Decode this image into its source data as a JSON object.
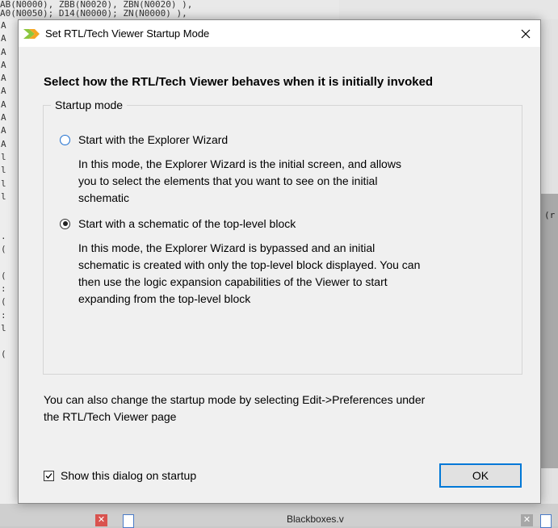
{
  "background": {
    "code_top_line": "AB(N0000), ZBB(N0020), ZBN(N0020)  ),",
    "code_second_line": "A0(N0050);  D14(N0000);  ZN(N0000)  ),",
    "gutter_lines": [
      "A",
      "A",
      "A",
      "A",
      "A",
      "A",
      "A",
      "A",
      "A",
      "A",
      "l",
      "l",
      "l",
      "l",
      "",
      "",
      ".",
      "(",
      "",
      "(",
      ":",
      "(",
      ":",
      "l",
      "",
      "(",
      ""
    ],
    "right_edge_text": "(r",
    "bottom_tab_label": "Blackboxes.v"
  },
  "dialog": {
    "title": "Set RTL/Tech Viewer Startup Mode",
    "heading": "Select how the RTL/Tech Viewer behaves when it is initially invoked",
    "group_label": "Startup mode",
    "options": [
      {
        "label": "Start with the Explorer Wizard",
        "selected": false,
        "description_lines": [
          "In this mode, the Explorer Wizard is the initial screen, and allows",
          "you to select the elements that you want to see on the initial",
          "schematic"
        ]
      },
      {
        "label": "Start with a schematic of the top-level block",
        "selected": true,
        "description_lines": [
          "In this mode, the Explorer Wizard is bypassed and an initial",
          "schematic is created with only the top-level block displayed. You can",
          "then use the logic expansion capabilities of the Viewer to start",
          "expanding from the top-level block"
        ]
      }
    ],
    "footer_note_lines": [
      "You can also change the startup mode by selecting Edit->Preferences under",
      "the RTL/Tech Viewer page"
    ],
    "show_on_startup_label": "Show this dialog on startup",
    "show_on_startup_checked": true,
    "ok_label": "OK"
  },
  "colors": {
    "accent": "#0078d7",
    "dialog_bg": "#f0f0f0",
    "app_icon_green": "#8cc63f"
  }
}
